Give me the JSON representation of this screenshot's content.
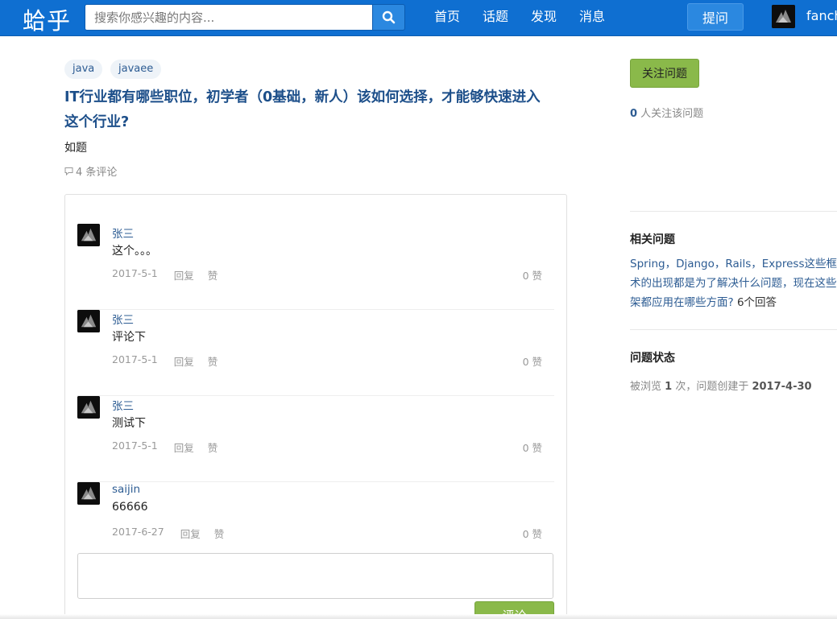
{
  "navbar": {
    "logo": "蛤乎",
    "search_placeholder": "搜索你感兴趣的内容...",
    "links": [
      "首页",
      "话题",
      "发现",
      "消息"
    ],
    "ask_label": "提问",
    "username": "fanch"
  },
  "question": {
    "tags": [
      "java",
      "javaee"
    ],
    "title": "IT行业都有哪些职位，初学者（0基础，新人）该如何选择，才能够快速进入这个行业?",
    "title_line1": "IT行业都有哪些职位，初学者（0基础，新人）该如何选择，才能够快速进入",
    "title_line2": "这个行业?",
    "description": "如题",
    "comment_count_label": "4 条评论"
  },
  "comments": [
    {
      "author": "张三",
      "text": "这个。。。",
      "date": "2017-5-1",
      "reply_label": "回复",
      "like_label": "赞",
      "likes": "0 赞"
    },
    {
      "author": "张三",
      "text": "评论下",
      "date": "2017-5-1",
      "reply_label": "回复",
      "like_label": "赞",
      "likes": "0 赞"
    },
    {
      "author": "张三",
      "text": "测试下",
      "date": "2017-5-1",
      "reply_label": "回复",
      "like_label": "赞",
      "likes": "0 赞"
    },
    {
      "author": "saijin",
      "text": "66666",
      "date": "2017-6-27",
      "reply_label": "回复",
      "like_label": "赞",
      "likes": "0 赞"
    }
  ],
  "comment_submit_label": "评论",
  "sidebar": {
    "follow_label": "关注问题",
    "follow_count": "0",
    "follow_text": " 人关注该问题",
    "related_title": "相关问题",
    "related_line1": "Spring，Django，Rails，Express这些框架技",
    "related_line2": "术的出现都是为了解决什么问题，现在这些框",
    "related_line3": "架都应用在哪些方面?",
    "related_answers": "6个回答",
    "status_title": "问题状态",
    "status_prefix": "被浏览 ",
    "views": "1",
    "status_mid": " 次，问题创建于 ",
    "created": "2017-4-30"
  },
  "colors": {
    "navbar": "#0f6fd1",
    "link": "#2d5c93",
    "green_button": "#8ab94a"
  },
  "icons": {
    "search": "search-icon",
    "comment": "comment-icon",
    "avatar": "avatar-image"
  }
}
